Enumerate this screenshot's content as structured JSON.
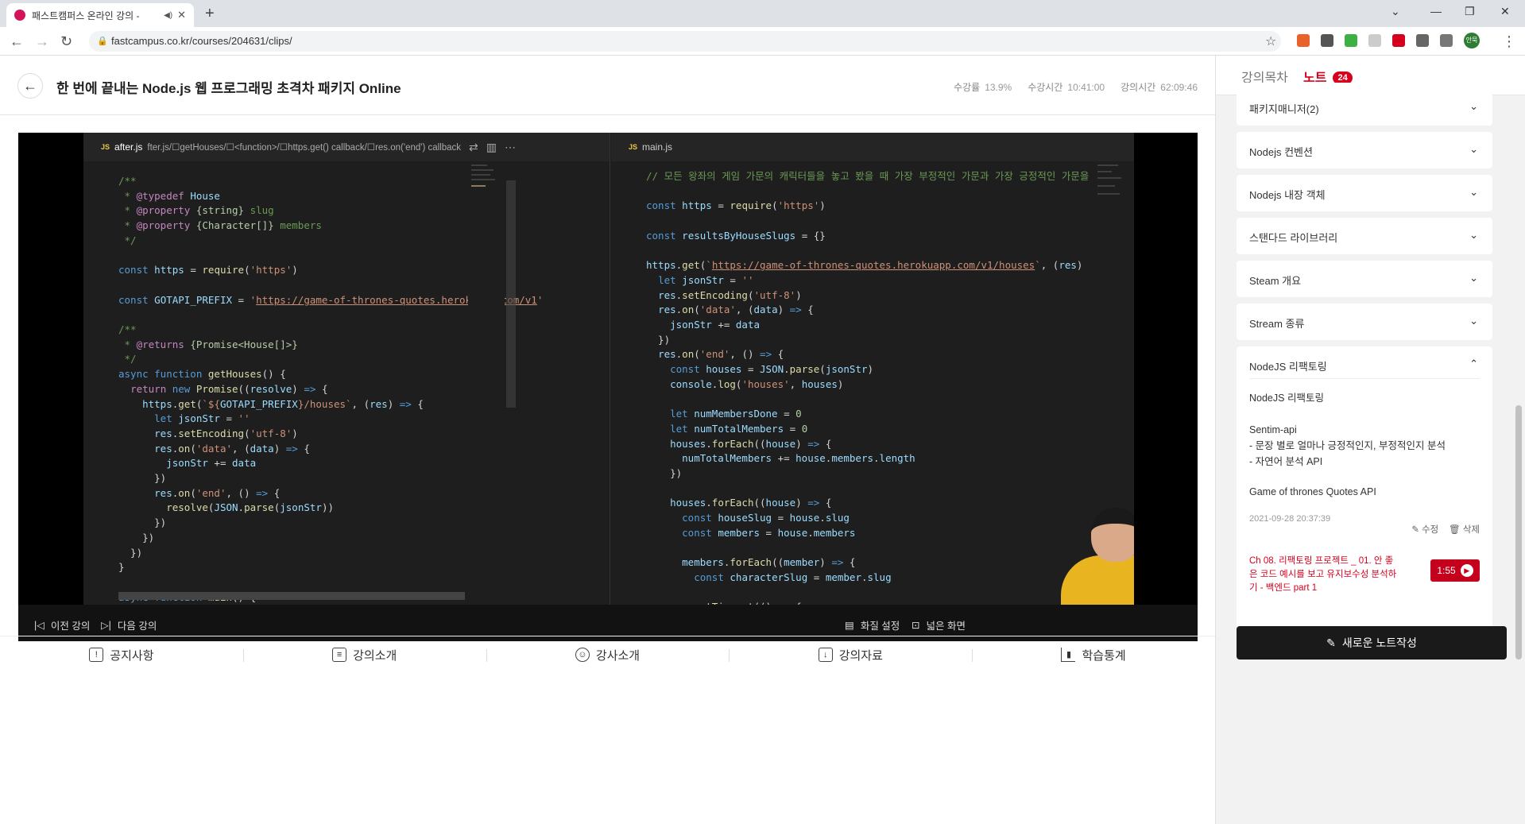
{
  "browser": {
    "tab_title": "패스트캠퍼스 온라인 강의 -",
    "url": "fastcampus.co.kr/courses/204631/clips/",
    "profile_label": "안묵"
  },
  "header": {
    "title": "한 번에 끝내는 Node.js 웹 프로그래밍 초격차 패키지 Online",
    "progress_label": "수강률",
    "progress_value": "13.9%",
    "watch_label": "수강시간",
    "watch_value": "10:41:00",
    "lecture_label": "강의시간",
    "lecture_value": "62:09:46"
  },
  "editor": {
    "left_tab": "after.js",
    "left_crumbs": "fter.js/☐getHouses/☐<function>/☐https.get() callback/☐res.on('end') callback",
    "right_tab": "main.js"
  },
  "player_controls": {
    "prev": "이전 강의",
    "next": "다음 강의",
    "quality": "화질 설정",
    "wide": "넓은 화면"
  },
  "bottom_nav": [
    "공지사항",
    "강의소개",
    "강사소개",
    "강의자료",
    "학습통계"
  ],
  "sidebar": {
    "tab_toc": "강의목차",
    "tab_note": "노트",
    "note_count": "24",
    "sections": [
      "패키지매니저(2)",
      "Nodejs 컨벤션",
      "Nodejs 내장 객체",
      "스탠다드 라이브러리",
      "Steam 개요",
      "Stream 종류",
      "NodeJS 리팩토링"
    ],
    "note": {
      "title": "NodeJS 리팩토링",
      "line1": "Sentim-api",
      "line2": "- 문장 별로 얼마나 긍정적인지, 부정적인지 분석",
      "line3": "- 자연어 분석 API",
      "line4": "Game of thrones Quotes API",
      "date": "2021-09-28 20:37:39",
      "edit": "수정",
      "delete": "삭제",
      "chapter": "Ch 08. 리팩토링 프로젝트 _ 01. 안 좋은 코드 예시를 보고 유지보수성 분석하기 - 백엔드 part 1",
      "time": "1:55"
    },
    "new_note": "새로운 노트작성"
  }
}
